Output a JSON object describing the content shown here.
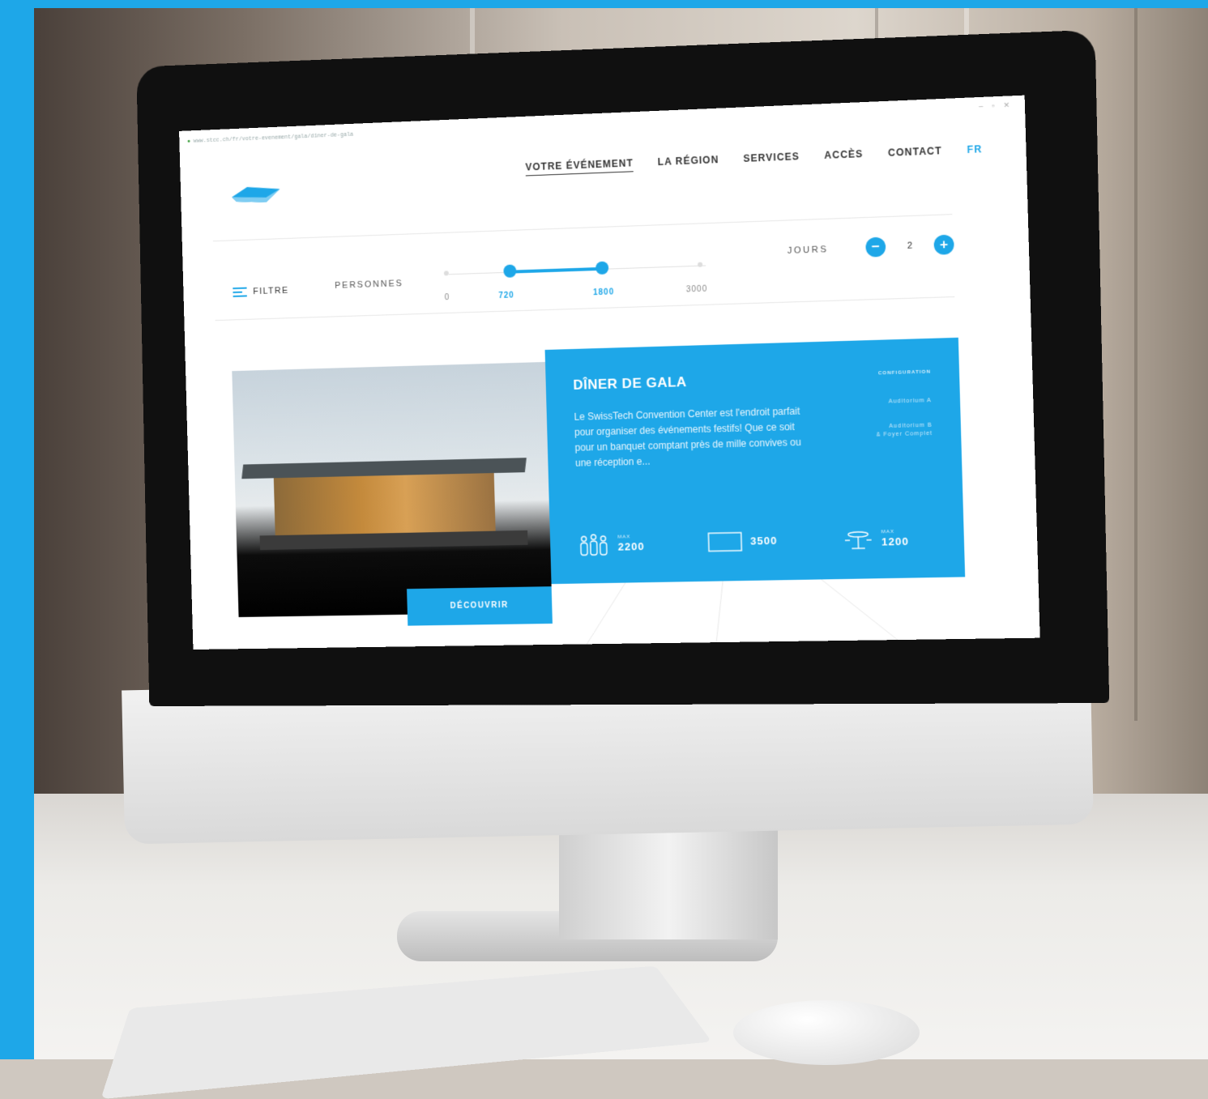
{
  "browser": {
    "url": "www.stcc.ch/fr/votre-evenement/gala/dîner-de-gala"
  },
  "nav": {
    "items": [
      "VOTRE ÉVÉNEMENT",
      "LA RÉGION",
      "SERVICES",
      "ACCÈS",
      "CONTACT"
    ],
    "lang": "FR"
  },
  "filter": {
    "label": "FILTRE",
    "persons_label": "PERSONNES",
    "slider": {
      "ticks": [
        "0",
        "720",
        "1800",
        "3000"
      ],
      "min": 0,
      "max": 3000,
      "low": 720,
      "high": 1800
    },
    "days_label": "JOURS",
    "days_value": "2",
    "minus": "−",
    "plus": "+"
  },
  "card": {
    "title": "DÎNER DE GALA",
    "description": "Le SwissTech Convention Center est l'endroit parfait pour organiser des événements festifs! Que ce soit pour un banquet comptant près de mille convives ou une réception e...",
    "config_label": "CONFIGURATION",
    "config_items": [
      "Auditorium A",
      "Auditorium B",
      "& Foyer Complet"
    ],
    "stats": [
      {
        "prefix": "MAX",
        "value": "2200",
        "icon": "people-icon"
      },
      {
        "prefix": "",
        "value": "3500",
        "icon": "screen-icon"
      },
      {
        "prefix": "MAX",
        "value": "1200",
        "icon": "table-icon"
      }
    ],
    "cta": "DÉCOUVRIR"
  },
  "colors": {
    "accent": "#1ea7e8"
  }
}
